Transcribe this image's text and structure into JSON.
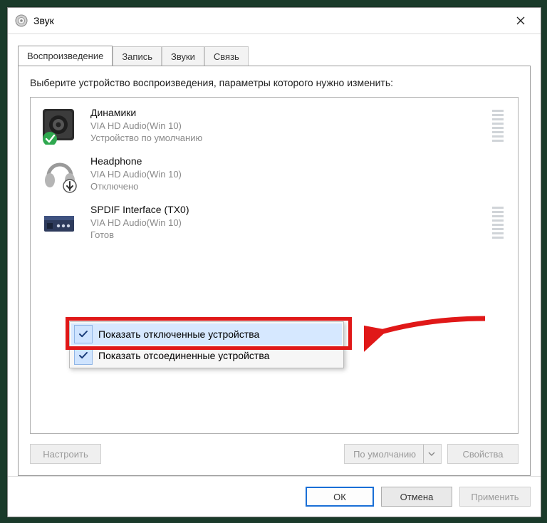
{
  "window": {
    "title": "Звук"
  },
  "tabs": [
    {
      "label": "Воспроизведение"
    },
    {
      "label": "Запись"
    },
    {
      "label": "Звуки"
    },
    {
      "label": "Связь"
    }
  ],
  "instruction": "Выберите устройство воспроизведения, параметры которого нужно изменить:",
  "devices": [
    {
      "name": "Динамики",
      "driver": "VIA HD Audio(Win 10)",
      "status": "Устройство по умолчанию"
    },
    {
      "name": "Headphone",
      "driver": "VIA HD Audio(Win 10)",
      "status": "Отключено"
    },
    {
      "name": "SPDIF Interface (TX0)",
      "driver": "VIA HD Audio(Win 10)",
      "status": "Готов"
    }
  ],
  "context_menu": [
    {
      "label": "Показать отключенные устройства",
      "checked": true,
      "highlighted": true
    },
    {
      "label": "Показать отсоединенные устройства",
      "checked": true,
      "highlighted": false
    }
  ],
  "lower_buttons": {
    "configure": "Настроить",
    "set_default": "По умолчанию",
    "properties": "Свойства"
  },
  "dialog_buttons": {
    "ok": "ОК",
    "cancel": "Отмена",
    "apply": "Применить"
  }
}
